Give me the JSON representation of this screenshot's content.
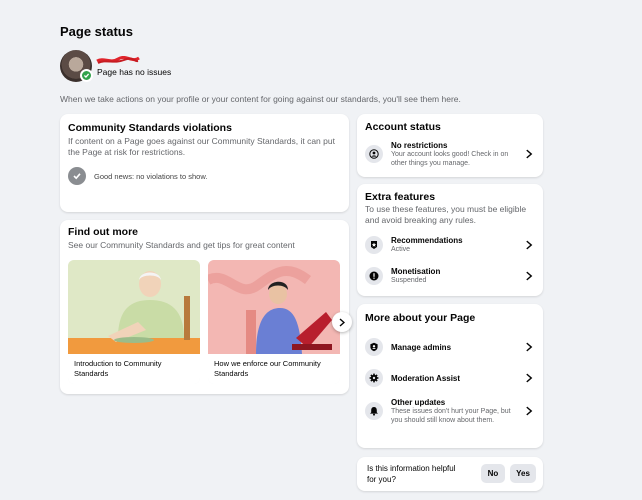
{
  "header": {
    "title": "Page status",
    "status": "Page has no issues",
    "intro": "When we take actions on your profile or your content for going against our standards, you'll see them here."
  },
  "violations": {
    "title": "Community Standards violations",
    "description": "If content on a Page goes against our Community Standards, it can put the Page at risk for restrictions.",
    "good_news": "Good news: no violations to show."
  },
  "find_out": {
    "title": "Find out more",
    "subtitle": "See our Community Standards and get tips for great content",
    "items": [
      {
        "label": "Introduction to Community Standards"
      },
      {
        "label": "How we enforce our Community Standards"
      }
    ]
  },
  "account_status": {
    "title": "Account status",
    "item": {
      "title": "No restrictions",
      "sub": "Your account looks good! Check in on other things you manage."
    }
  },
  "extra": {
    "title": "Extra features",
    "description": "To use these features, you must be eligible and avoid breaking any rules.",
    "items": [
      {
        "title": "Recommendations",
        "sub": "Active"
      },
      {
        "title": "Monetisation",
        "sub": "Suspended"
      }
    ]
  },
  "more": {
    "title": "More about your Page",
    "items": [
      {
        "title": "Manage admins"
      },
      {
        "title": "Moderation Assist"
      },
      {
        "title": "Other updates",
        "sub": "These issues don't hurt your Page, but you should still know about them."
      }
    ]
  },
  "feedback": {
    "question": "Is this information helpful for you?",
    "no": "No",
    "yes": "Yes"
  }
}
